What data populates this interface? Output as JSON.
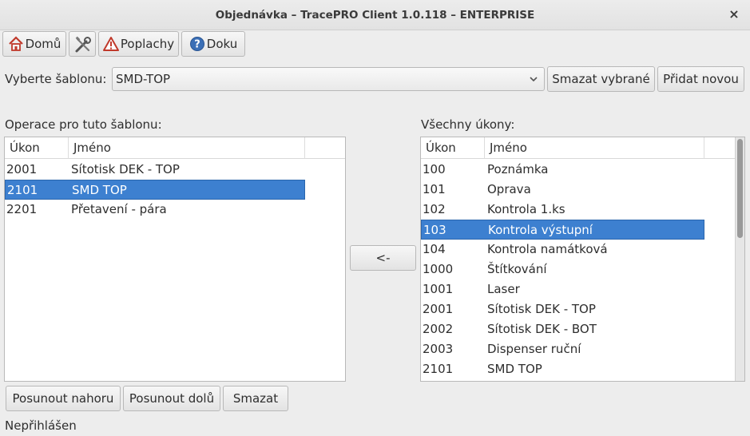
{
  "window": {
    "title": "Objednávka – TracePRO Client 1.0.118 – ENTERPRISE",
    "close_glyph": "×"
  },
  "toolbar": {
    "home_label": "Domů",
    "tools_icon": "tools-icon",
    "alarms_label": "Poplachy",
    "docs_label": "Doku"
  },
  "template": {
    "label": "Vyberte šablonu:",
    "selected": "SMD-TOP",
    "delete_selected_label": "Smazat vybrané",
    "add_new_label": "Přidat novou"
  },
  "left_table": {
    "title": "Operace pro tuto šablonu:",
    "columns": [
      "Úkon",
      "Jméno"
    ],
    "rows": [
      {
        "code": "2001",
        "name": "Sítotisk DEK - TOP",
        "selected": false
      },
      {
        "code": "2101",
        "name": "SMD TOP",
        "selected": true
      },
      {
        "code": "2201",
        "name": "Přetavení - pára",
        "selected": false
      }
    ]
  },
  "transfer_button": "<-",
  "right_table": {
    "title": "Všechny úkony:",
    "columns": [
      "Úkon",
      "Jméno"
    ],
    "rows": [
      {
        "code": "100",
        "name": "Poznámka",
        "selected": false
      },
      {
        "code": "101",
        "name": "Oprava",
        "selected": false
      },
      {
        "code": "102",
        "name": "Kontrola 1.ks",
        "selected": false
      },
      {
        "code": "103",
        "name": "Kontrola výstupní",
        "selected": true
      },
      {
        "code": "104",
        "name": "Kontrola namátková",
        "selected": false
      },
      {
        "code": "1000",
        "name": "Štítkování",
        "selected": false
      },
      {
        "code": "1001",
        "name": "Laser",
        "selected": false
      },
      {
        "code": "2001",
        "name": "Sítotisk DEK - TOP",
        "selected": false
      },
      {
        "code": "2002",
        "name": "Sítotisk DEK - BOT",
        "selected": false
      },
      {
        "code": "2003",
        "name": "Dispenser ruční",
        "selected": false
      },
      {
        "code": "2101",
        "name": "SMD TOP",
        "selected": false
      }
    ]
  },
  "bottom_buttons": {
    "move_up": "Posunout nahoru",
    "move_down": "Posunout dolů",
    "delete": "Smazat"
  },
  "status": {
    "text": "Nepřihlášen"
  },
  "colors": {
    "selection": "#3d80d0",
    "window_bg": "#ededed"
  }
}
